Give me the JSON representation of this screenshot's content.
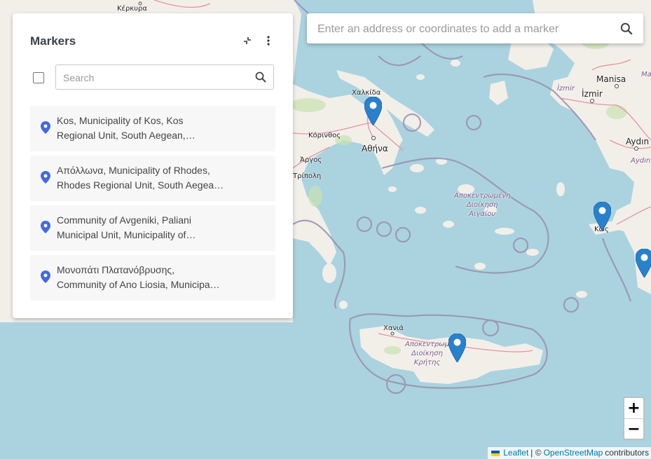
{
  "panel": {
    "title": "Markers",
    "collapse_icon": "collapse-arrows-icon",
    "menu_icon": "more-vert-icon",
    "search_placeholder": "Search",
    "search_value": "",
    "items": [
      {
        "line1": "Kos, Municipality of Kos, Kos",
        "line2": "Regional Unit, South Aegean,…"
      },
      {
        "line1": "Απόλλωνα, Municipality of Rhodes,",
        "line2": "Rhodes Regional Unit, South Aegea…"
      },
      {
        "line1": "Community of Avgeniki, Paliani",
        "line2": "Municipal Unit, Municipality of…"
      },
      {
        "line1": "Μονοπάτι Πλατανόβρυσης,",
        "line2": "Community of Ano Liosia, Municipa…"
      }
    ]
  },
  "address_search": {
    "placeholder": "Enter an address or coordinates to add a marker",
    "value": ""
  },
  "zoom": {
    "in_label": "+",
    "out_label": "−"
  },
  "attribution": {
    "leaflet": "Leaflet",
    "separator": "| ©",
    "osm": "OpenStreetMap",
    "suffix": "contributors"
  },
  "map_labels": {
    "kerkyra": "Κέρκυρα",
    "chalkida": "Χαλκίδα",
    "korinthos": "Κόρινθος",
    "athina": "Αθήνα",
    "argos": "Άργος",
    "tripoli": "Τρίπολη",
    "izmir_region": "İzmir",
    "izmir": "İzmir",
    "manisa": "Manisa",
    "manisa_region": "Ma",
    "aydin": "Aydın",
    "aydin_region": "Aydın",
    "aegean_region_1": "Αποκεντρωμένη",
    "aegean_region_2": "Διοίκηση",
    "aegean_region_3": "Αιγαίου",
    "kos": "Κως",
    "chania": "Χανιά",
    "crete_region_1": "Αποκεντρωμ",
    "crete_region_2": "Διοίκηση",
    "crete_region_3": "Κρήτης"
  },
  "colors": {
    "sea": "#aad3df",
    "land": "#f2efe9",
    "accent_pin": "#4169e1",
    "marker": "#2a81cb",
    "boundary": "#9a8fb0"
  }
}
